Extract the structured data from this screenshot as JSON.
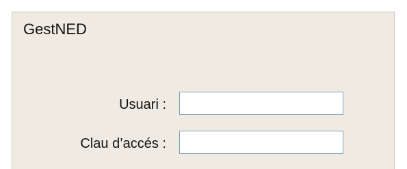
{
  "app": {
    "title": "GestNED"
  },
  "login_form": {
    "username_label": "Usuari :",
    "username_value": "",
    "password_label": "Clau d’accés :",
    "password_value": ""
  }
}
